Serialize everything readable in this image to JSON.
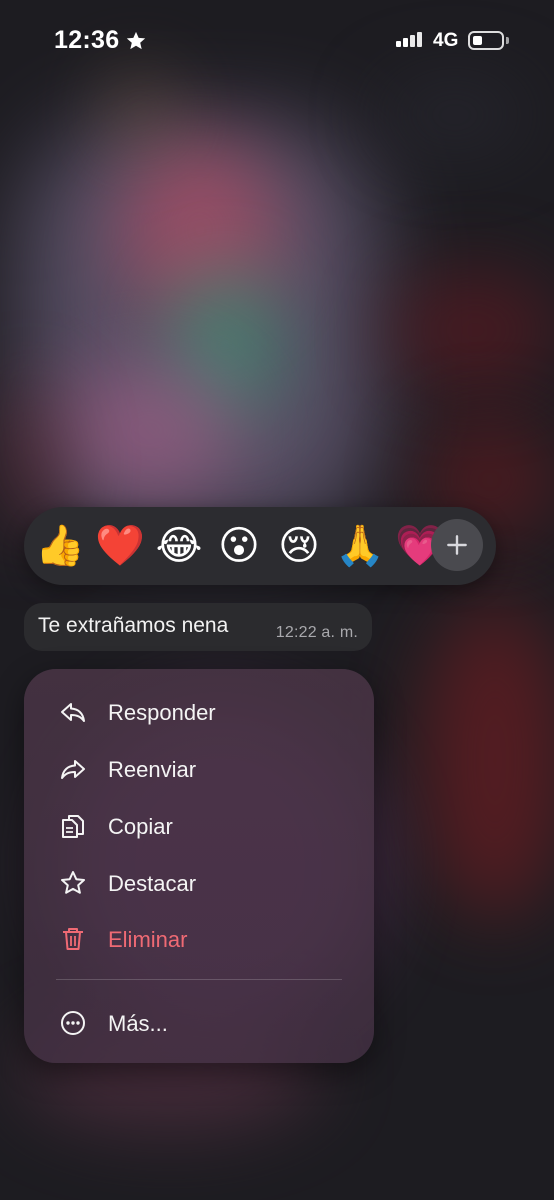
{
  "status_bar": {
    "time": "12:36",
    "network": "4G"
  },
  "reactions": {
    "emojis": [
      "👍",
      "❤️",
      "😂",
      "😮",
      "😢",
      "🙏",
      "💗"
    ],
    "more_icon": "plus-icon"
  },
  "message": {
    "text": "Te extrañamos nena",
    "timestamp": "12:22 a. m."
  },
  "menu": {
    "items": [
      {
        "label": "Responder",
        "icon": "reply-icon"
      },
      {
        "label": "Reenviar",
        "icon": "forward-icon"
      },
      {
        "label": "Copiar",
        "icon": "copy-icon"
      },
      {
        "label": "Destacar",
        "icon": "star-icon"
      },
      {
        "label": "Eliminar",
        "icon": "trash-icon"
      },
      {
        "label": "Más...",
        "icon": "more-icon"
      }
    ]
  },
  "colors": {
    "danger": "#ef6a74",
    "bubble": "#2b2b2e",
    "reaction_bar": "#2c2c30"
  }
}
